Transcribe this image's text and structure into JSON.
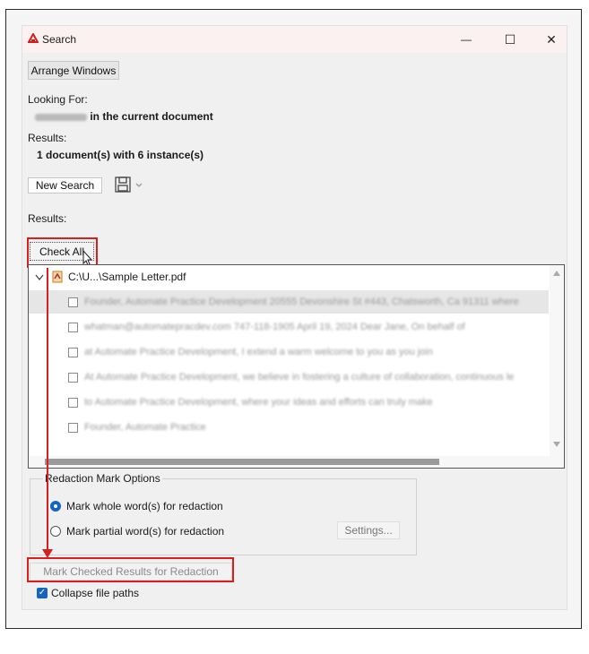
{
  "window": {
    "title": "Search",
    "minimize_glyph": "—",
    "maximize_glyph": "☐",
    "close_glyph": "✕"
  },
  "toolbar": {
    "arrange_windows": "Arrange Windows"
  },
  "looking_for": {
    "label": "Looking For:",
    "scope_text": "in the current document"
  },
  "results_summary": {
    "label": "Results:",
    "value": "1 document(s) with 6 instance(s)"
  },
  "actions": {
    "new_search": "New Search"
  },
  "results_section": {
    "label": "Results:",
    "check_all": "Check All"
  },
  "tree": {
    "file_label": "C:\\U...\\Sample Letter.pdf",
    "items": [
      "Founder, Automate Practice Development 20555 Devonshire St #443, Chatsworth, Ca 91311 where",
      "whatman@automatepracdev.com 747-118-1905 April 19, 2024 Dear Jane, On behalf of",
      "at Automate Practice Development, I extend a warm welcome to you as you join",
      "At Automate Practice Development, we believe in fostering a culture of collaboration, continuous le",
      "to Automate Practice Development, where your ideas and efforts can truly make",
      "Founder, Automate Practice"
    ]
  },
  "redaction_options": {
    "group_label": "Redaction Mark Options",
    "whole_words": "Mark whole word(s) for redaction",
    "partial_words": "Mark partial word(s) for redaction",
    "settings": "Settings..."
  },
  "mark_checked": "Mark Checked Results for Redaction",
  "collapse_paths": {
    "label": "Collapse file paths",
    "checked": true
  },
  "colors": {
    "accent": "#1565c0",
    "annotation_red": "#d61f1f"
  }
}
